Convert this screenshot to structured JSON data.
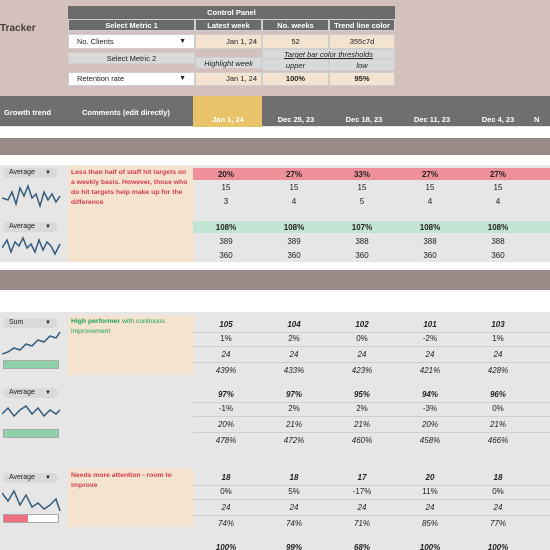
{
  "app": {
    "title_fragment": "Tracker"
  },
  "control_panel": {
    "title": "Control Panel",
    "select_metric_1_label": "Select Metric 1",
    "select_metric_1_value": "No. Clients",
    "select_metric_2_label": "Select Metric 2",
    "select_metric_2_value": "Retention rate",
    "latest_week_label": "Latest week",
    "latest_week_1": "Jan 1, 24",
    "latest_week_2": "Jan 1, 24",
    "no_weeks_label": "No. weeks",
    "no_weeks_value": "52",
    "trend_color_label": "Trend line color",
    "trend_color_value": "355c7d",
    "highlight_week_label": "Highlight week",
    "target_thresholds_label": "Target bar color thresholds",
    "upper_label": "upper",
    "upper_value": "100%",
    "low_label": "low",
    "low_value": "95%"
  },
  "columns": {
    "growth_trend": "Growth trend",
    "comments": "Comments (edit directly)",
    "weeks": [
      "Jan 1, 24",
      "Dec 25, 23",
      "Dec 18, 23",
      "Dec 11, 23",
      "Dec 4, 23",
      "N"
    ]
  },
  "section1": {
    "rows": [
      {
        "agg": "Average",
        "comment": "Less than half of staff hit targets on a weekly basis. However, those who do hit targets help make up for the difference",
        "pct": [
          "20%",
          "27%",
          "33%",
          "27%",
          "27%"
        ],
        "r2": [
          "15",
          "15",
          "15",
          "15",
          "15"
        ],
        "r3": [
          "3",
          "4",
          "5",
          "4",
          "4"
        ]
      },
      {
        "agg": "Average",
        "pct": [
          "108%",
          "108%",
          "107%",
          "108%",
          "108%"
        ],
        "r2": [
          "389",
          "389",
          "388",
          "388",
          "388"
        ],
        "r3": [
          "360",
          "360",
          "360",
          "360",
          "360"
        ]
      }
    ]
  },
  "section2": {
    "rows": [
      {
        "agg": "Sum",
        "comment_hl": "High performer",
        "comment_rest": " with continous improvement",
        "v1": [
          "105",
          "104",
          "102",
          "101",
          "103"
        ],
        "v2": [
          "1%",
          "2%",
          "0%",
          "-2%",
          "1%"
        ],
        "v3": [
          "24",
          "24",
          "24",
          "24",
          "24"
        ],
        "v4": [
          "439%",
          "433%",
          "423%",
          "421%",
          "428%"
        ],
        "bar": 1.0,
        "bar_color": "#8fd1a8"
      },
      {
        "agg": "Average",
        "v1": [
          "97%",
          "97%",
          "95%",
          "94%",
          "96%"
        ],
        "v2": [
          "-1%",
          "2%",
          "2%",
          "-3%",
          "0%"
        ],
        "v3": [
          "20%",
          "21%",
          "21%",
          "20%",
          "21%"
        ],
        "v4": [
          "478%",
          "472%",
          "460%",
          "458%",
          "466%"
        ],
        "bar": 1.0,
        "bar_color": "#8fd1a8"
      },
      {
        "agg": "Average",
        "comment": "Needs more attention - room to improve",
        "v1": [
          "18",
          "18",
          "17",
          "20",
          "18"
        ],
        "v2": [
          "0%",
          "5%",
          "-17%",
          "11%",
          "0%"
        ],
        "v3": [
          "24",
          "24",
          "24",
          "24",
          "24"
        ],
        "v4": [
          "74%",
          "74%",
          "71%",
          "85%",
          "77%"
        ],
        "bar": 0.45,
        "bar_color": "#ef6f7f"
      }
    ],
    "last_partial": [
      "100%",
      "99%",
      "68%",
      "100%",
      "100%"
    ]
  },
  "colors": {
    "trend": "#355c7d",
    "accent_highlight": "#e8c36a",
    "red_band": "#ef8f99",
    "green_band": "#c3e4d4"
  }
}
